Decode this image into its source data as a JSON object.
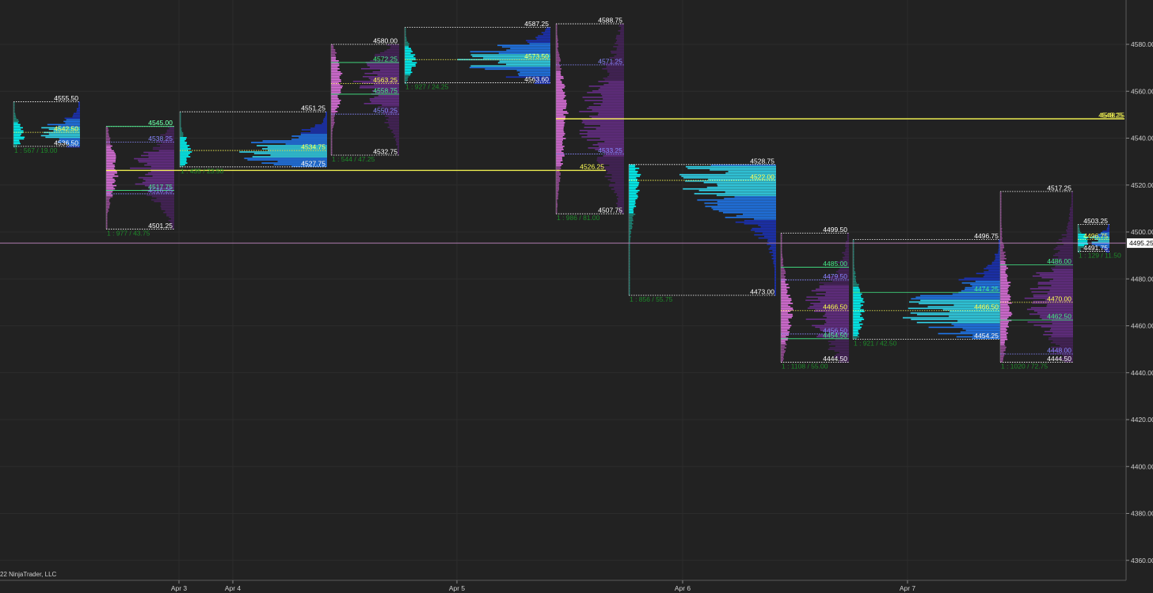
{
  "copyright": "22 NinjaTrader, LLC",
  "colors": {
    "background": "#222222",
    "poc": "#ffff55",
    "vah_val": "#44ee88",
    "vwap": "#8888ff",
    "high_low": "#ffffff",
    "summary": "#1e8a2a",
    "profile_cyan": "#00ffff",
    "profile_blue": "#1f4fff",
    "profile_pink": "#e273e2",
    "profile_teal": "#1d8a7a",
    "profile_purple": "#5a2a78",
    "current_price_line": "#c58ac5"
  },
  "chart_data": {
    "type": "volume-profile",
    "ylim": [
      4350,
      4600
    ],
    "y_ticks": [
      "4580.00",
      "4560.00",
      "4540.00",
      "4520.00",
      "4500.00",
      "4480.00",
      "4460.00",
      "4440.00",
      "4420.00",
      "4400.00",
      "4380.00",
      "4360.00"
    ],
    "x_ticks": [
      "Apr 3",
      "Apr 4",
      "Apr 5",
      "Apr 6",
      "Apr 7"
    ],
    "current_price": "4495.25",
    "grid": true,
    "profiles": [
      {
        "high": 4555.5,
        "low": 4536.5,
        "high_label": "4555.50",
        "low_label": "4536.50",
        "poc": 4542.5,
        "poc_label": "4542.50",
        "poc_extend_to": null,
        "vah": null,
        "vah_label": null,
        "val": null,
        "val_label": null,
        "vwap": null,
        "vwap_label": null,
        "summary": "1 : 567 / 19.00",
        "left_style": "cyan",
        "right_style": "blue"
      },
      {
        "high": 4545.0,
        "low": 4501.25,
        "high_label": "4545.00",
        "low_label": "4501.25",
        "poc": 4526.25,
        "poc_label": "4526.25",
        "poc_extend_to": 765,
        "vah": 4545.0,
        "vah_label": "4545.00",
        "val": 4517.75,
        "val_label": "4517.75",
        "vwap": 4538.25,
        "vwap_label": "4538.25",
        "vwap2": 4516.25,
        "vwap2_label": "4516.25",
        "summary": "1 : 977 / 43.75",
        "left_style": "pink",
        "right_style": "purple"
      },
      {
        "high": 4551.25,
        "low": 4527.75,
        "high_label": "4551.25",
        "low_label": "4527.75",
        "poc": 4534.75,
        "poc_label": "4534.75",
        "poc_extend_to": null,
        "vah": null,
        "vah_label": null,
        "val": null,
        "val_label": null,
        "vwap": null,
        "vwap_label": null,
        "summary": "1 : 435 / 23.50",
        "left_style": "cyan",
        "right_style": "blue"
      },
      {
        "high": 4580.0,
        "low": 4532.75,
        "high_label": "4580.00",
        "low_label": "4532.75",
        "poc": 4563.25,
        "poc_label": "4563.25",
        "poc_extend_to": null,
        "vah": 4572.25,
        "vah_label": "4572.25",
        "val": 4558.75,
        "val_label": "4558.75",
        "vwap": 4550.25,
        "vwap_label": "4550.25",
        "summary": "1 : 544 / 47.25",
        "left_style": "pink",
        "right_style": "purple"
      },
      {
        "high": 4587.25,
        "low": 4563.6,
        "high_label": "4587.25",
        "low_label": "4563.60",
        "poc": 4573.5,
        "poc_label": "4573.50",
        "poc_extend_to": null,
        "vah": null,
        "vah_label": null,
        "val": null,
        "val_label": null,
        "vwap": null,
        "vwap_label": null,
        "summary": "1 : 927 / 24.25",
        "left_style": "cyan",
        "right_style": "blue"
      },
      {
        "high": 4588.75,
        "low": 4507.75,
        "high_label": "4588.75",
        "low_label": "4507.75",
        "poc": 4548.25,
        "poc_label": "4548.25",
        "poc_extend_to": 1420,
        "vah": null,
        "vah_label": null,
        "val": null,
        "val_label": null,
        "vwap": 4571.25,
        "vwap_label": "4571.25",
        "vwap2": 4533.25,
        "vwap2_label": "4533.25",
        "summary": "1 : 986 / 81.00",
        "left_style": "pink",
        "right_style": "purple"
      },
      {
        "high": 4528.75,
        "low": 4473.0,
        "high_label": "4528.75",
        "low_label": "4473.00",
        "poc": 4522.0,
        "poc_label": "4522.00",
        "poc_extend_to": null,
        "vah": null,
        "vah_label": null,
        "val": null,
        "val_label": null,
        "vwap": null,
        "vwap_label": null,
        "summary": "1 : 856 / 55.75",
        "left_style": "cyan",
        "right_style": "blue"
      },
      {
        "high": 4499.5,
        "low": 4444.5,
        "high_label": "4499.50",
        "low_label": "4444.50",
        "poc": 4466.5,
        "poc_label": "4466.50",
        "poc_extend_to": null,
        "vah": 4485.0,
        "vah_label": "4485.00",
        "val": 4454.5,
        "val_label": "4454.50",
        "vwap": 4479.5,
        "vwap_label": "4479.50",
        "vwap2": 4456.5,
        "vwap2_label": "4456.50",
        "summary": "1 : 1108 / 55.00",
        "left_style": "pink",
        "right_style": "purple"
      },
      {
        "high": 4496.75,
        "low": 4454.25,
        "high_label": "4496.75",
        "low_label": "4454.25",
        "poc": 4466.5,
        "poc_label": "4466.50",
        "poc_extend_to": null,
        "vah": 4474.25,
        "vah_label": "4474.25",
        "val": null,
        "val_label": null,
        "vwap": null,
        "vwap_label": null,
        "summary": "1 : 921 / 42.50",
        "left_style": "cyan",
        "right_style": "blue"
      },
      {
        "high": 4517.25,
        "low": 4444.5,
        "high_label": "4517.25",
        "low_label": "4444.50",
        "poc": 4470.0,
        "poc_label": "4470.00",
        "poc_extend_to": null,
        "vah": 4486.0,
        "vah_label": "4486.00",
        "val": 4462.5,
        "val_label": "4462.50",
        "vwap": 4448.0,
        "vwap_label": "4448.00",
        "summary": "1 : 1020 / 72.75",
        "left_style": "pink",
        "right_style": "purple"
      },
      {
        "high": 4503.25,
        "low": 4491.75,
        "high_label": "4503.25",
        "low_label": "4491.75",
        "poc": 4496.75,
        "poc_label": "4496.75",
        "poc_extend_to": null,
        "vah": null,
        "vah_label": null,
        "val": null,
        "val_label": null,
        "vwap": null,
        "vwap_label": null,
        "summary": "1 : 129 / 11.50",
        "left_style": "cyan",
        "right_style": "blue"
      }
    ]
  }
}
